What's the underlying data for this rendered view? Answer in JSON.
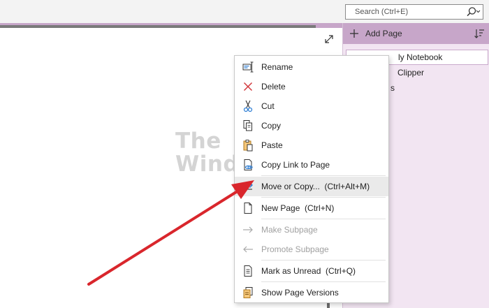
{
  "search": {
    "placeholder": "Search (Ctrl+E)",
    "icon": "search-icon",
    "dropdown_icon": "chevron-down-icon"
  },
  "page_pane": {
    "add_page_label": "Add Page",
    "pages": [
      {
        "label": "ly Notebook",
        "selected": true
      },
      {
        "label": "Clipper",
        "selected": false
      },
      {
        "label": "s",
        "selected": false
      }
    ]
  },
  "watermark": {
    "line1": "The",
    "line2": "WindowsClub"
  },
  "context_menu": {
    "items": [
      {
        "label": "Rename",
        "icon": "rename-icon",
        "enabled": true
      },
      {
        "label": "Delete",
        "icon": "delete-icon",
        "enabled": true
      },
      {
        "label": "Cut",
        "icon": "scissors-icon",
        "enabled": true
      },
      {
        "label": "Copy",
        "icon": "copy-icon",
        "enabled": true
      },
      {
        "label": "Paste",
        "icon": "paste-icon",
        "enabled": true
      },
      {
        "label": "Copy Link to Page",
        "icon": "link-icon",
        "enabled": true
      },
      {
        "label": "Move or Copy...  (Ctrl+Alt+M)",
        "icon": "move-arrow-icon",
        "enabled": true,
        "highlighted": true
      },
      {
        "label": "New Page  (Ctrl+N)",
        "icon": "new-page-icon",
        "enabled": true
      },
      {
        "label": "Make Subpage",
        "icon": "indent-arrow-icon",
        "enabled": false
      },
      {
        "label": "Promote Subpage",
        "icon": "outdent-arrow-icon",
        "enabled": false
      },
      {
        "label": "Mark as Unread  (Ctrl+Q)",
        "icon": "mark-unread-icon",
        "enabled": true
      },
      {
        "label": "Show Page Versions",
        "icon": "page-versions-icon",
        "enabled": true
      }
    ]
  },
  "colors": {
    "section_accent": "#c7a6c9",
    "page_pane_bg": "#f2e5f2",
    "arrow": "#d9262c",
    "move_icon": "#2b7cd3"
  }
}
